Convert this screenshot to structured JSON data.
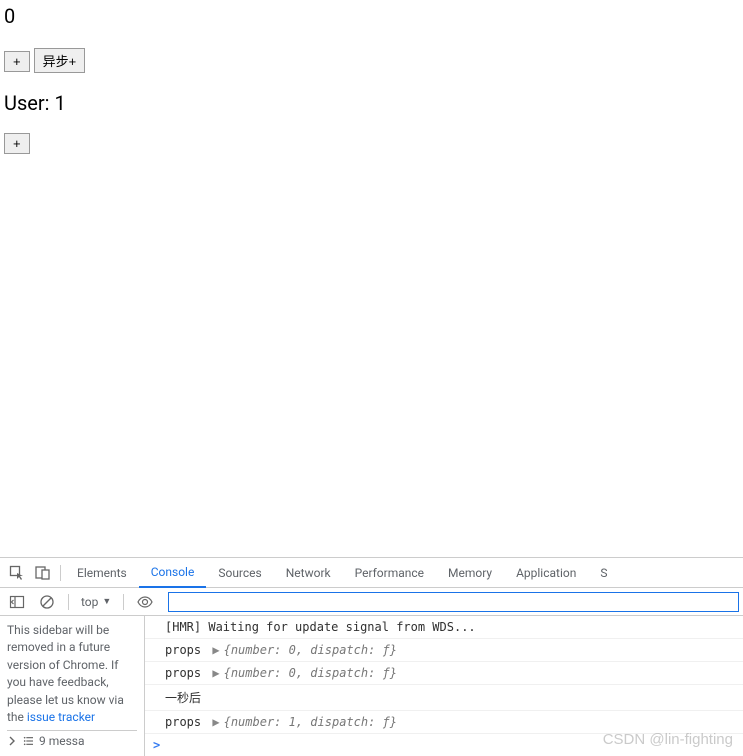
{
  "app": {
    "counter_value": "0",
    "buttons": {
      "plus": "+",
      "async_plus": "异步+"
    },
    "user_label": "User: 1",
    "second_plus": "+"
  },
  "devtools": {
    "tabs": {
      "elements": "Elements",
      "console": "Console",
      "sources": "Sources",
      "network": "Network",
      "performance": "Performance",
      "memory": "Memory",
      "application": "Application",
      "more": "S"
    },
    "toolbar": {
      "context": "top",
      "filter_placeholder": ""
    },
    "sidebar": {
      "notice": "This sidebar will be removed in a future version of Chrome. If you have feedback, please let us know via the ",
      "link_text": "issue tracker",
      "footer": "9 messa"
    },
    "console": {
      "rows": [
        {
          "type": "log",
          "text": "[HMR] Waiting for update signal from WDS..."
        },
        {
          "type": "obj",
          "label": "props",
          "preview": "{number: 0, dispatch: ƒ}"
        },
        {
          "type": "obj",
          "label": "props",
          "preview": "{number: 0, dispatch: ƒ}"
        },
        {
          "type": "log",
          "text": "一秒后"
        },
        {
          "type": "obj",
          "label": "props",
          "preview": "{number: 1, dispatch: ƒ}"
        }
      ],
      "prompt": ">"
    }
  },
  "watermark": "CSDN @lin-fighting"
}
